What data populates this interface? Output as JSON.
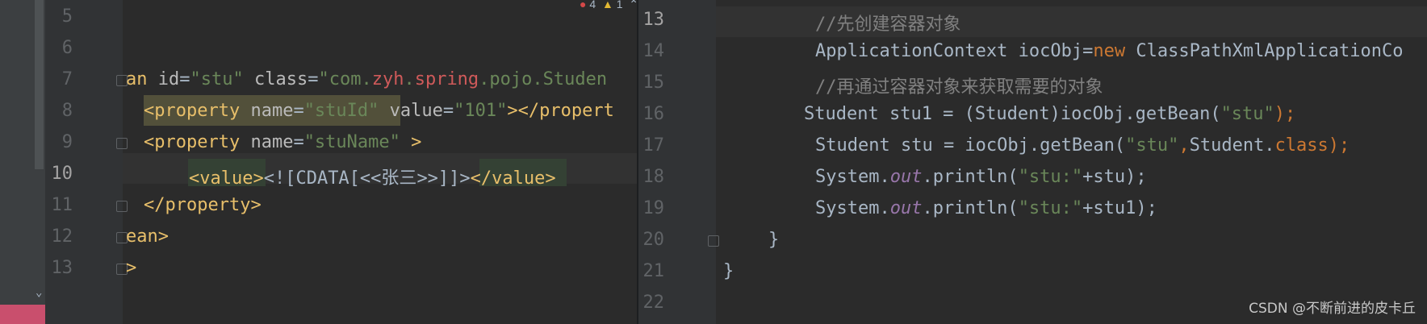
{
  "inspections": {
    "error_icon": "error-icon",
    "errors": "4",
    "warn_icon": "warning-icon",
    "warnings": "1",
    "up": "⌃",
    "down": "⌄"
  },
  "left_editor": {
    "lines": [
      {
        "num": "5"
      },
      {
        "num": "6"
      },
      {
        "num": "7"
      },
      {
        "num": "8"
      },
      {
        "num": "9"
      },
      {
        "num": "10"
      },
      {
        "num": "11"
      },
      {
        "num": "12"
      },
      {
        "num": "13"
      }
    ],
    "l7": {
      "a": "an ",
      "b": "id",
      "c": "=",
      "d": "\"stu\"",
      "e": " class",
      "f": "=",
      "g": "\"com.",
      "h": "zyh",
      "i": ".",
      "j": "spring",
      "k": ".pojo.Studen"
    },
    "l8": {
      "a": "<property ",
      "b": "name",
      "c": "=",
      "d": "\"stuId\"",
      "e": " value",
      "f": "=",
      "g": "\"101\"",
      "h": "></propert"
    },
    "l9": {
      "a": "<property ",
      "b": "name",
      "c": "=",
      "d": "\"stuName\"",
      "e": " >"
    },
    "l10": {
      "a": "<value>",
      "b": "<![CDATA[<<",
      "c": "张三",
      "d": ">>]]>",
      "e": "</value>"
    },
    "l11": {
      "a": "</property>"
    },
    "l12": {
      "a": "ean>"
    },
    "l13": {
      "a": ">"
    }
  },
  "right_editor": {
    "lines": [
      {
        "num": "13"
      },
      {
        "num": "14"
      },
      {
        "num": "15"
      },
      {
        "num": "16"
      },
      {
        "num": "17"
      },
      {
        "num": "18"
      },
      {
        "num": "19"
      },
      {
        "num": "20"
      },
      {
        "num": "21"
      },
      {
        "num": "22"
      }
    ],
    "r13": {
      "a": "//",
      "b": "先创建容器对象"
    },
    "r14": {
      "a": "ApplicationContext iocObj=",
      "b": "new",
      "c": " ClassPathXmlApplicationCo"
    },
    "r15": {
      "a": "//",
      "b": "再通过容器对象来获取需要的对象"
    },
    "r16": {
      "a": "Student stu1 = (Student)iocObj.getBean(",
      "b": "\"stu\"",
      "c": ");"
    },
    "r17": {
      "a": "Student stu = iocObj.getBean(",
      "b": "\"stu\"",
      "c": ",",
      "d": "Student.",
      "e": "class",
      "f": ");"
    },
    "r18": {
      "a": "System.",
      "b": "out",
      "c": ".println(",
      "d": "\"stu:\"",
      "e": "+stu);"
    },
    "r19": {
      "a": "System.",
      "b": "out",
      "c": ".println(",
      "d": "\"stu:\"",
      "e": "+stu1);"
    },
    "r20": {
      "a": "}"
    },
    "r21": {
      "a": "}"
    }
  },
  "watermark": "CSDN @不断前进的皮卡丘",
  "colors": {
    "background": "#2b2b2b",
    "gutter": "#313335",
    "tag": "#e8bf6a",
    "string": "#6a8759",
    "keyword": "#cc7832",
    "comment": "#808080",
    "field": "#9876aa"
  }
}
